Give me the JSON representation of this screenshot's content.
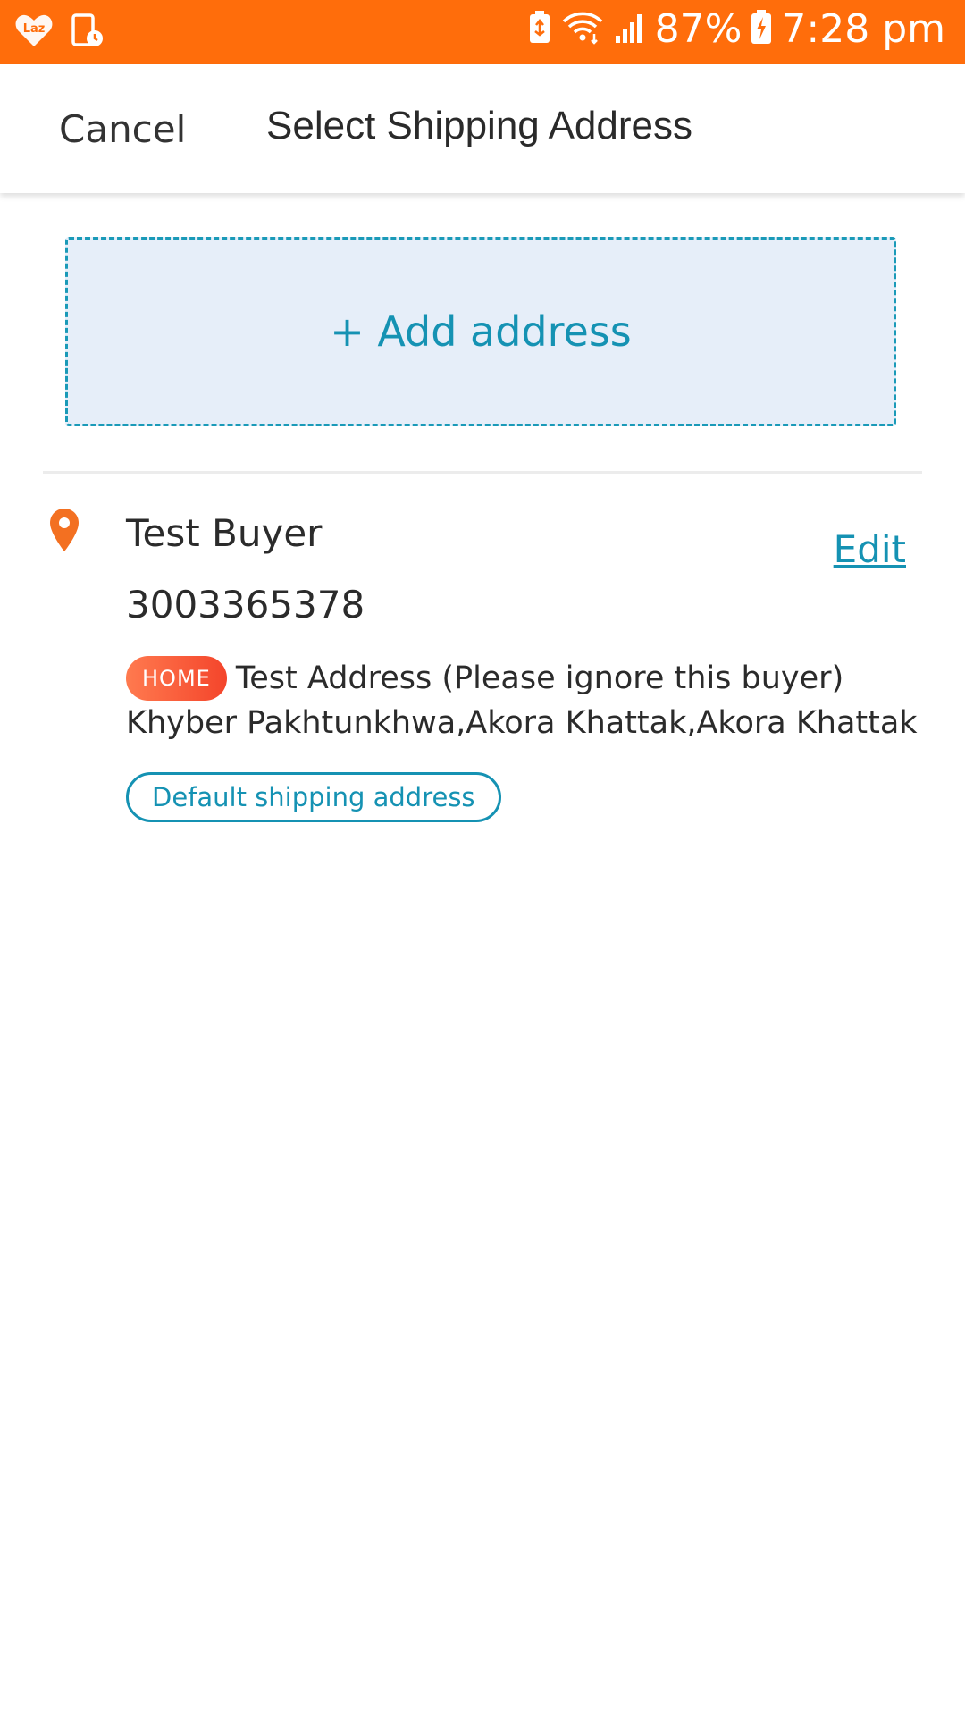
{
  "status_bar": {
    "battery_percent": "87%",
    "time": "7:28 pm",
    "background_color": "#ff6d0b",
    "icons_left": [
      "lazada-app-icon",
      "screen-timer-icon"
    ],
    "icons_right": [
      "battery-saver-icon",
      "wifi-icon",
      "signal-icon",
      "battery-charging-icon"
    ]
  },
  "header": {
    "cancel_label": "Cancel",
    "title": "Select Shipping Address"
  },
  "add_address": {
    "label": "+ Add address"
  },
  "addresses": [
    {
      "name": "Test Buyer",
      "phone": "3003365378",
      "tag": "HOME",
      "address_line1": "Test Address (Please ignore this buyer)",
      "address_line2": "Khyber Pakhtunkhwa,Akora Khattak,Akora Khattak",
      "default_label": "Default shipping address",
      "edit_label": "Edit",
      "icon": "location-pin-icon"
    }
  ],
  "colors": {
    "accent": "#1592b3",
    "brand": "#ff6d0b",
    "pin": "#f37021",
    "home_badge": "#f4452b"
  }
}
